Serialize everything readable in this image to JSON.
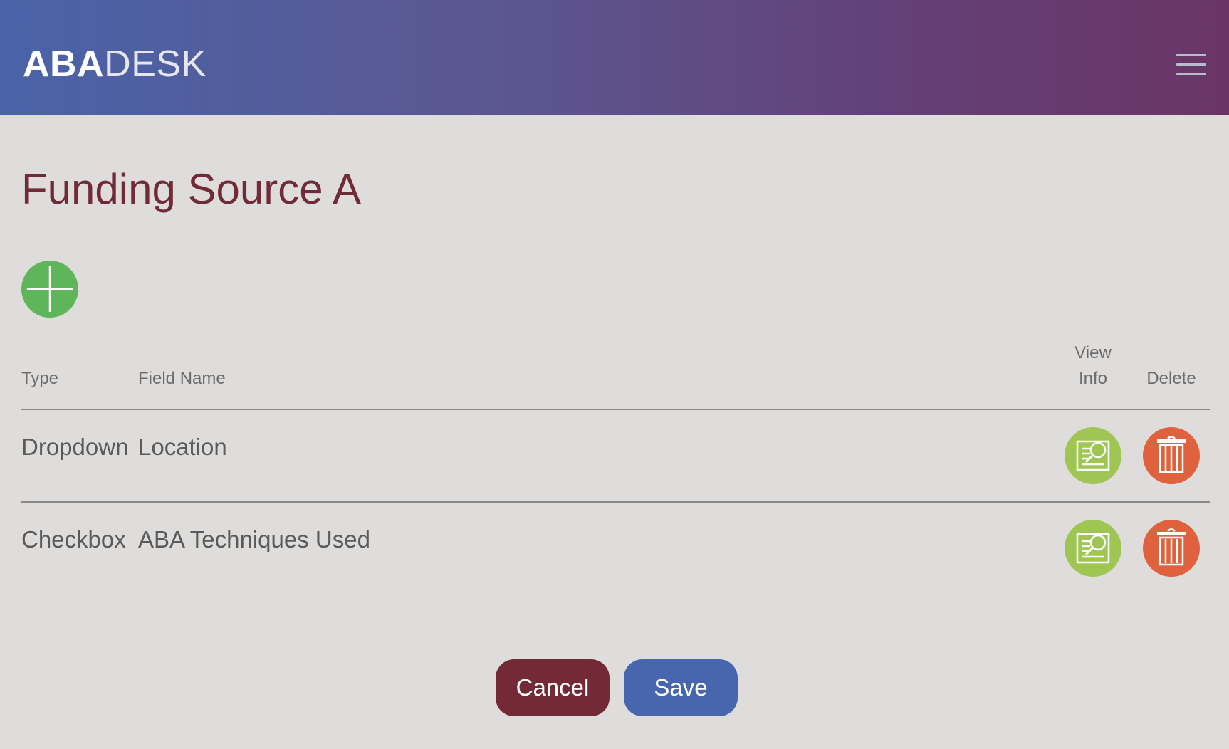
{
  "header": {
    "logo_bold": "ABA",
    "logo_light": "DESK",
    "menu_icon": "hamburger-menu-icon"
  },
  "page": {
    "title": "Funding Source A",
    "add_icon": "plus-icon"
  },
  "table": {
    "columns": {
      "type": "Type",
      "field_name": "Field Name",
      "view_info_line1": "View",
      "view_info_line2": "Info",
      "delete": "Delete"
    },
    "rows": [
      {
        "type": "Dropdown",
        "field_name": "Location"
      },
      {
        "type": "Checkbox",
        "field_name": "ABA Techniques Used"
      }
    ],
    "view_icon": "document-search-icon",
    "delete_icon": "trash-icon"
  },
  "footer": {
    "cancel_label": "Cancel",
    "save_label": "Save"
  },
  "colors": {
    "title": "#712a37",
    "add_button": "#5fb55a",
    "view_button": "#9fc553",
    "delete_button": "#e0613d",
    "cancel_button": "#732936",
    "save_button": "#4766ad"
  }
}
